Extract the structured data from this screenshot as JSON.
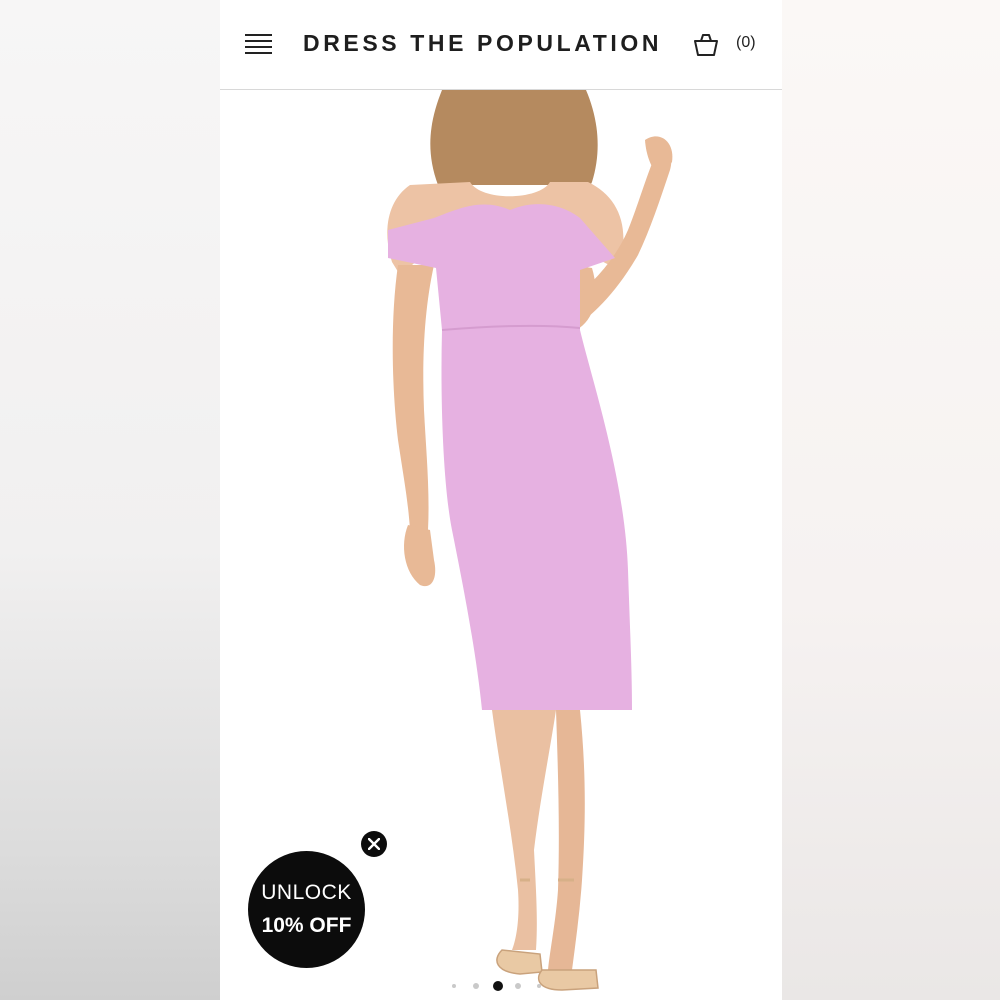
{
  "header": {
    "brand": "DRESS THE POPULATION",
    "cart_count": "(0)",
    "menu_icon": "hamburger-menu-icon",
    "cart_icon": "shopping-basket-icon"
  },
  "product": {
    "dress_color": "#e6b1e1",
    "image_icon": "model-in-dress-image"
  },
  "promo": {
    "line1": "UNLOCK",
    "line2": "10% OFF",
    "close_icon": "close-icon"
  },
  "carousel": {
    "total": 5,
    "active_index": 2
  },
  "colors": {
    "brand_text": "#1e1e1e",
    "promo_bg": "#0c0c0c",
    "active_dot": "#111111",
    "inactive_dot": "#c9c9c9"
  }
}
